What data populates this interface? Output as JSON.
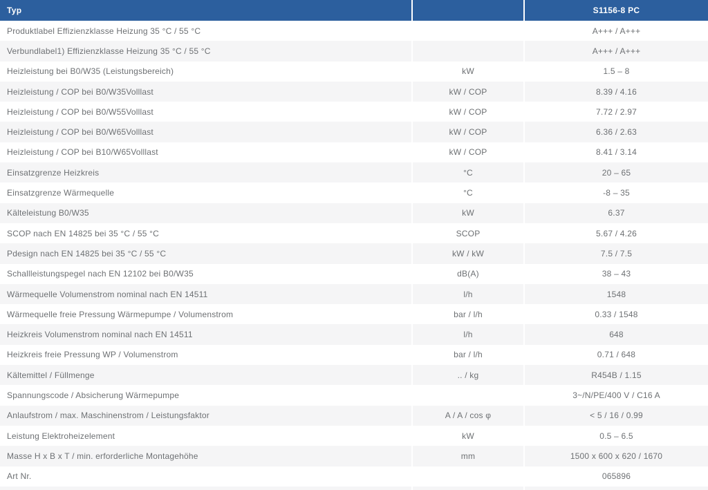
{
  "table": {
    "header": {
      "col_type": "Typ",
      "col_unit": "",
      "col_value": "S1156-8 PC"
    },
    "rows": [
      {
        "label": "Produktlabel Effizienzklasse Heizung 35 °C / 55 °C",
        "unit": "",
        "value": "A+++ / A+++"
      },
      {
        "label": "Verbundlabel1) Effizienzklasse Heizung 35 °C / 55 °C",
        "unit": "",
        "value": "A+++ / A+++"
      },
      {
        "label": "Heizleistung bei B0/W35 (Leistungsbereich)",
        "unit": "kW",
        "value": "1.5 – 8"
      },
      {
        "label": "Heizleistung / COP bei B0/W35Volllast",
        "unit": "kW / COP",
        "value": "8.39 / 4.16"
      },
      {
        "label": "Heizleistung / COP bei B0/W55Volllast",
        "unit": "kW / COP",
        "value": "7.72 / 2.97"
      },
      {
        "label": "Heizleistung / COP bei B0/W65Volllast",
        "unit": "kW / COP",
        "value": "6.36 / 2.63"
      },
      {
        "label": "Heizleistung / COP bei B10/W65Volllast",
        "unit": "kW / COP",
        "value": "8.41 / 3.14"
      },
      {
        "label": "Einsatzgrenze Heizkreis",
        "unit": "°C",
        "value": "20 – 65"
      },
      {
        "label": "Einsatzgrenze Wärmequelle",
        "unit": "°C",
        "value": "-8 – 35"
      },
      {
        "label": "Kälteleistung B0/W35",
        "unit": "kW",
        "value": "6.37"
      },
      {
        "label": "SCOP nach EN 14825 bei 35 °C / 55 °C",
        "unit": "SCOP",
        "value": "5.67 / 4.26"
      },
      {
        "label": "Pdesign nach EN 14825 bei 35 °C / 55 °C",
        "unit": "kW / kW",
        "value": "7.5 / 7.5"
      },
      {
        "label": "Schallleistungspegel nach EN 12102 bei B0/W35",
        "unit": "dB(A)",
        "value": "38 – 43"
      },
      {
        "label": "Wärmequelle Volumenstrom nominal nach EN 14511",
        "unit": "l/h",
        "value": "1548"
      },
      {
        "label": "Wärmequelle freie Pressung Wärmepumpe / Volumenstrom",
        "unit": "bar / l/h",
        "value": "0.33 / 1548"
      },
      {
        "label": "Heizkreis Volumenstrom nominal nach EN 14511",
        "unit": "l/h",
        "value": "648"
      },
      {
        "label": "Heizkreis freie Pressung WP / Volumenstrom",
        "unit": "bar / l/h",
        "value": "0.71 / 648"
      },
      {
        "label": "Kältemittel / Füllmenge",
        "unit": ".. / kg",
        "value": "R454B / 1.15"
      },
      {
        "label": "Spannungscode / Absicherung Wärmepumpe",
        "unit": "",
        "value": "3~/N/PE/400 V / C16 A"
      },
      {
        "label": "Anlaufstrom / max. Maschinenstrom / Leistungsfaktor",
        "unit": "A / A / cos φ",
        "value": "< 5 / 16 / 0.99"
      },
      {
        "label": "Leistung Elektroheizelement",
        "unit": "kW",
        "value": "0.5 – 6.5"
      },
      {
        "label": "Masse H x B x T / min. erforderliche Montagehöhe",
        "unit": "mm",
        "value": "1500 x 600 x 620 / 1670"
      },
      {
        "label": "Art Nr.",
        "unit": "",
        "value": "065896"
      }
    ],
    "colors": {
      "header_bg": "#2c5f9e",
      "header_text": "#ffffff",
      "row_bg": "#ffffff",
      "row_alt_bg": "#f5f5f6",
      "body_text": "#6d7073",
      "divider": "#ffffff"
    }
  }
}
